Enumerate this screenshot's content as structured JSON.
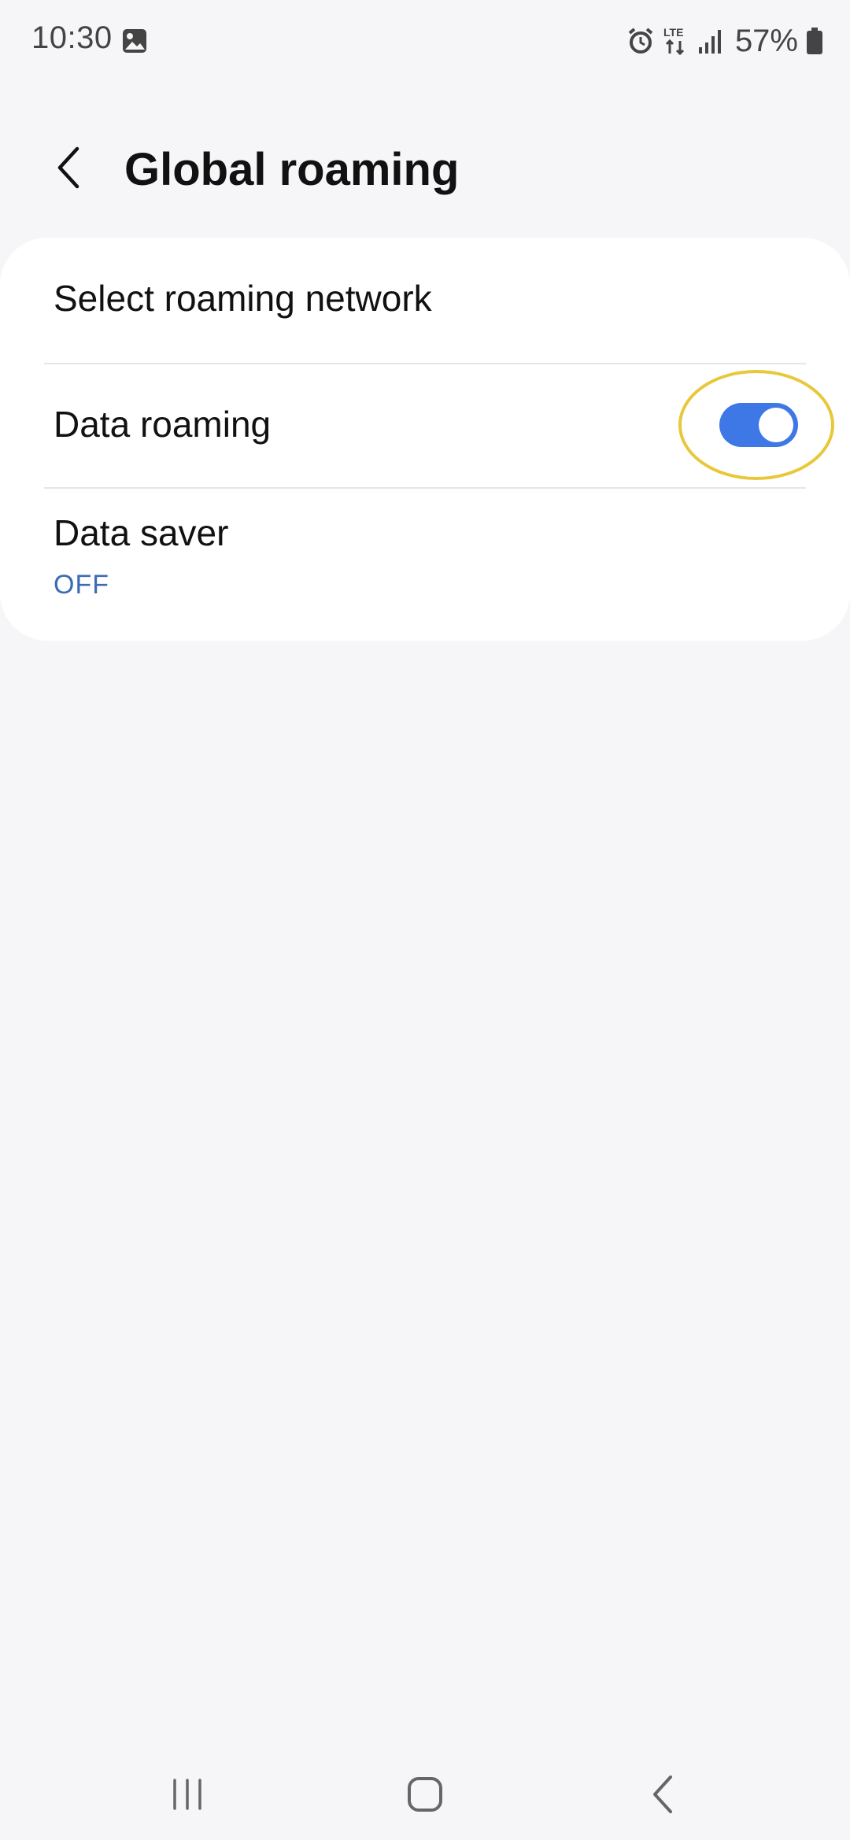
{
  "status_bar": {
    "time": "10:30",
    "battery_percent": "57%",
    "icons": [
      "gallery-icon",
      "alarm-icon",
      "lte-icon",
      "signal-icon",
      "battery-icon"
    ]
  },
  "header": {
    "title": "Global roaming",
    "back_icon": "chevron-left-icon"
  },
  "settings": {
    "select_network": {
      "label": "Select roaming network"
    },
    "data_roaming": {
      "label": "Data roaming",
      "enabled": true
    },
    "data_saver": {
      "label": "Data saver",
      "status": "OFF"
    }
  },
  "nav_bar": {
    "buttons": [
      "recent-apps-icon",
      "home-icon",
      "back-icon"
    ]
  },
  "colors": {
    "background": "#f6f6f8",
    "card": "#ffffff",
    "toggle_on": "#3e78e6",
    "status_blue": "#3d6bb3",
    "highlight": "#e8c83a"
  }
}
